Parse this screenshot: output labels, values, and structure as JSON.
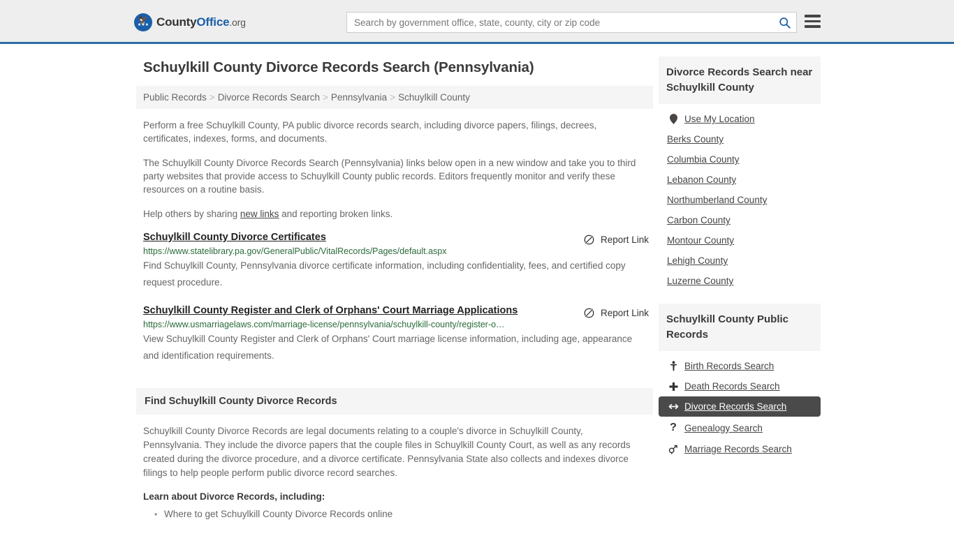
{
  "header": {
    "brand": {
      "part1": "County",
      "part2": "Office",
      "tld": ".org",
      "logo_icon": "eagle-seal-icon"
    },
    "search": {
      "placeholder": "Search by government office, state, county, city or zip code",
      "value": "",
      "button_icon": "search-icon"
    },
    "menu_icon": "hamburger-menu-icon"
  },
  "main": {
    "title": "Schuylkill County Divorce Records Search (Pennsylvania)",
    "breadcrumb": [
      {
        "label": "Public Records"
      },
      {
        "label": "Divorce Records Search"
      },
      {
        "label": "Pennsylvania"
      },
      {
        "label": "Schuylkill County"
      }
    ],
    "breadcrumb_separator": ">",
    "paragraphs": [
      "Perform a free Schuylkill County, PA public divorce records search, including divorce papers, filings, decrees, certificates, indexes, forms, and documents.",
      "The Schuylkill County Divorce Records Search (Pennsylvania) links below open in a new window and take you to third party websites that provide access to Schuylkill County public records. Editors frequently monitor and verify these resources on a routine basis."
    ],
    "share": {
      "before": "Help others by sharing ",
      "link": "new links",
      "after": " and reporting broken links."
    },
    "report_label": "Report Link",
    "report_icon": "broken-link-icon",
    "results": [
      {
        "title": "Schuylkill County Divorce Certificates",
        "url": "https://www.statelibrary.pa.gov/GeneralPublic/VitalRecords/Pages/default.aspx",
        "description": "Find Schuylkill County, Pennsylvania divorce certificate information, including confidentiality, fees, and certified copy request procedure."
      },
      {
        "title": "Schuylkill County Register and Clerk of Orphans' Court Marriage Applications",
        "url": "https://www.usmarriagelaws.com/marriage-license/pennsylvania/schuylkill-county/register-o…",
        "description": "View Schuylkill County Register and Clerk of Orphans' Court marriage license information, including age, appearance and identification requirements."
      }
    ],
    "section": {
      "heading": "Find Schuylkill County Divorce Records",
      "body": "Schuylkill County Divorce Records are legal documents relating to a couple's divorce in Schuylkill County, Pennsylvania. They include the divorce papers that the couple files in Schuylkill County Court, as well as any records created during the divorce procedure, and a divorce certificate. Pennsylvania State also collects and indexes divorce filings to help people perform public divorce record searches.",
      "learn_heading": "Learn about Divorce Records, including:",
      "bullets": [
        "Where to get Schuylkill County Divorce Records online"
      ]
    }
  },
  "sidebar": {
    "nearby": {
      "heading": "Divorce Records Search near Schuylkill County",
      "items": [
        {
          "label": "Use My Location",
          "icon": "map-pin-icon"
        },
        {
          "label": "Berks County",
          "icon": ""
        },
        {
          "label": "Columbia County",
          "icon": ""
        },
        {
          "label": "Lebanon County",
          "icon": ""
        },
        {
          "label": "Northumberland County",
          "icon": ""
        },
        {
          "label": "Carbon County",
          "icon": ""
        },
        {
          "label": "Montour County",
          "icon": ""
        },
        {
          "label": "Lehigh County",
          "icon": ""
        },
        {
          "label": "Luzerne County",
          "icon": ""
        }
      ]
    },
    "public_records": {
      "heading": "Schuylkill County Public Records",
      "items": [
        {
          "label": "Birth Records Search",
          "icon": "baby-icon",
          "active": false
        },
        {
          "label": "Death Records Search",
          "icon": "cross-icon",
          "active": false
        },
        {
          "label": "Divorce Records Search",
          "icon": "arrows-split-icon",
          "active": true
        },
        {
          "label": "Genealogy Search",
          "icon": "question-mark-icon",
          "active": false
        },
        {
          "label": "Marriage Records Search",
          "icon": "mars-venus-icon",
          "active": false
        }
      ]
    }
  },
  "colors": {
    "header_bg": "#eeeeee",
    "header_border": "#2e6da4",
    "brand_blue": "#1a5fa8",
    "url_green": "#2a6b3a",
    "panel_bg": "#f5f5f5",
    "active_bg": "#4a4a4a"
  }
}
